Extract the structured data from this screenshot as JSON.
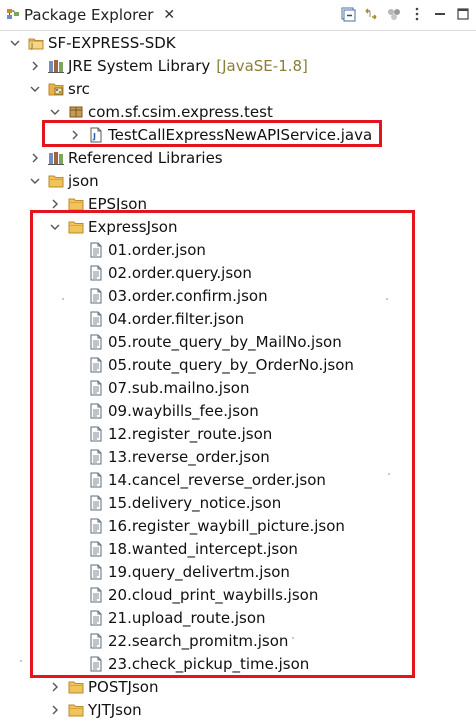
{
  "view": {
    "title": "Package Explorer",
    "close": "✕"
  },
  "toolbar": [
    {
      "name": "collapse-all-icon"
    },
    {
      "name": "link-with-editor-icon"
    },
    {
      "name": "focus-icon"
    },
    {
      "name": "view-menu-icon"
    }
  ],
  "tree": [
    {
      "id": "project",
      "level": 0,
      "twisty": "open",
      "icon": "project",
      "label": "SF-EXPRESS-SDK"
    },
    {
      "id": "jre",
      "level": 1,
      "twisty": "closed",
      "icon": "library",
      "label": "JRE System Library",
      "decoration": "[JavaSE-1.8]"
    },
    {
      "id": "src",
      "level": 1,
      "twisty": "open",
      "icon": "srcfolder",
      "label": "src"
    },
    {
      "id": "pkg",
      "level": 2,
      "twisty": "open",
      "icon": "package",
      "label": "com.sf.csim.express.test"
    },
    {
      "id": "javafile",
      "level": 3,
      "twisty": "closed",
      "icon": "javafile",
      "label": "TestCallExpressNewAPIService.java"
    },
    {
      "id": "reflibs",
      "level": 1,
      "twisty": "closed",
      "icon": "library",
      "label": "Referenced Libraries"
    },
    {
      "id": "json",
      "level": 1,
      "twisty": "open",
      "icon": "folder",
      "label": "json"
    },
    {
      "id": "eps",
      "level": 2,
      "twisty": "closed",
      "icon": "folder",
      "label": "EPSJson"
    },
    {
      "id": "express",
      "level": 2,
      "twisty": "open",
      "icon": "folder",
      "label": "ExpressJson"
    },
    {
      "id": "f01",
      "level": 3,
      "twisty": "none",
      "icon": "file",
      "label": "01.order.json"
    },
    {
      "id": "f02",
      "level": 3,
      "twisty": "none",
      "icon": "file",
      "label": "02.order.query.json"
    },
    {
      "id": "f03",
      "level": 3,
      "twisty": "none",
      "icon": "file",
      "label": "03.order.confirm.json"
    },
    {
      "id": "f04",
      "level": 3,
      "twisty": "none",
      "icon": "file",
      "label": "04.order.filter.json"
    },
    {
      "id": "f05a",
      "level": 3,
      "twisty": "none",
      "icon": "file",
      "label": "05.route_query_by_MailNo.json"
    },
    {
      "id": "f05b",
      "level": 3,
      "twisty": "none",
      "icon": "file",
      "label": "05.route_query_by_OrderNo.json"
    },
    {
      "id": "f07",
      "level": 3,
      "twisty": "none",
      "icon": "file",
      "label": "07.sub.mailno.json"
    },
    {
      "id": "f09",
      "level": 3,
      "twisty": "none",
      "icon": "file",
      "label": "09.waybills_fee.json"
    },
    {
      "id": "f12",
      "level": 3,
      "twisty": "none",
      "icon": "file",
      "label": "12.register_route.json"
    },
    {
      "id": "f13",
      "level": 3,
      "twisty": "none",
      "icon": "file",
      "label": "13.reverse_order.json"
    },
    {
      "id": "f14",
      "level": 3,
      "twisty": "none",
      "icon": "file",
      "label": "14.cancel_reverse_order.json"
    },
    {
      "id": "f15",
      "level": 3,
      "twisty": "none",
      "icon": "file",
      "label": "15.delivery_notice.json"
    },
    {
      "id": "f16",
      "level": 3,
      "twisty": "none",
      "icon": "file",
      "label": "16.register_waybill_picture.json"
    },
    {
      "id": "f18",
      "level": 3,
      "twisty": "none",
      "icon": "file",
      "label": "18.wanted_intercept.json"
    },
    {
      "id": "f19",
      "level": 3,
      "twisty": "none",
      "icon": "file",
      "label": "19.query_delivertm.json"
    },
    {
      "id": "f20",
      "level": 3,
      "twisty": "none",
      "icon": "file",
      "label": "20.cloud_print_waybills.json"
    },
    {
      "id": "f21",
      "level": 3,
      "twisty": "none",
      "icon": "file",
      "label": "21.upload_route.json"
    },
    {
      "id": "f22",
      "level": 3,
      "twisty": "none",
      "icon": "file",
      "label": "22.search_promitm.json"
    },
    {
      "id": "f23",
      "level": 3,
      "twisty": "none",
      "icon": "file",
      "label": "23.check_pickup_time.json"
    },
    {
      "id": "post",
      "level": 2,
      "twisty": "closed",
      "icon": "folder",
      "label": "POSTJson"
    },
    {
      "id": "yjt",
      "level": 2,
      "twisty": "closed",
      "icon": "folder",
      "label": "YJTJson"
    }
  ],
  "highlights": [
    {
      "name": "highlight-java-file",
      "rows": [
        "javafile",
        "javafile"
      ]
    },
    {
      "name": "highlight-expressjson-folder",
      "rows": [
        "express",
        "f23"
      ]
    }
  ],
  "colors": {
    "highlight": "#e3141c",
    "folder": "#e8b44a",
    "decoration": "#8b7d3a"
  }
}
